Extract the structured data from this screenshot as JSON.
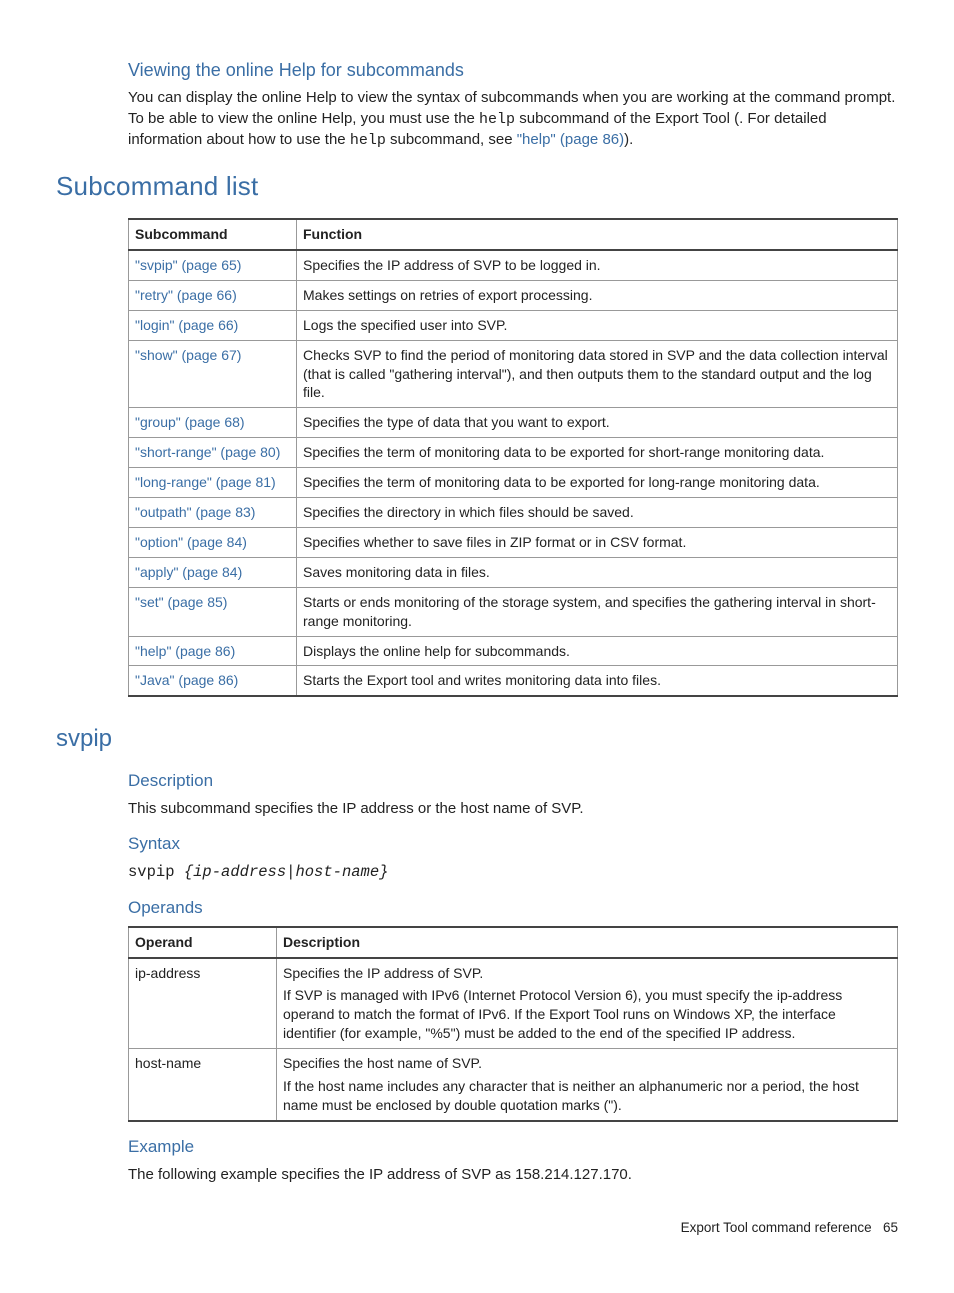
{
  "section1": {
    "heading": "Viewing the online Help for subcommands",
    "para_a": "You can display the online Help to view the syntax of subcommands when you are working at the command prompt. To be able to view the online Help, you must use the ",
    "help1": "help",
    "para_b": " subcommand of the Export Tool (. For detailed information about how to use the ",
    "help2": "help",
    "para_c": " subcommand, see ",
    "link": "\"help\" (page 86)",
    "para_d": ")."
  },
  "subcmd": {
    "heading": "Subcommand list",
    "col1": "Subcommand",
    "col2": "Function",
    "rows": [
      {
        "name": "\"svpip\" (page 65)",
        "func": "Specifies the IP address of SVP to be logged in."
      },
      {
        "name": "\"retry\" (page 66)",
        "func": "Makes settings on retries of export processing."
      },
      {
        "name": "\"login\" (page 66)",
        "func": "Logs the specified user into SVP."
      },
      {
        "name": "\"show\" (page 67)",
        "func": "Checks SVP to find the period of monitoring data stored in SVP and the data collection interval (that is called \"gathering interval\"), and then outputs them to the standard output and the log file."
      },
      {
        "name": "\"group\" (page 68)",
        "func": "Specifies the type of data that you want to export."
      },
      {
        "name": "\"short-range\" (page 80)",
        "func": "Specifies the term of monitoring data to be exported for short-range monitoring data."
      },
      {
        "name": "\"long-range\" (page 81)",
        "func": "Specifies the term of monitoring data to be exported for long-range monitoring data."
      },
      {
        "name": "\"outpath\" (page 83)",
        "func": "Specifies the directory in which files should be saved."
      },
      {
        "name": "\"option\" (page 84)",
        "func": "Specifies whether to save files in ZIP format or in CSV format."
      },
      {
        "name": "\"apply\" (page 84)",
        "func": "Saves monitoring data in files."
      },
      {
        "name": "\"set\" (page 85)",
        "func": "Starts or ends monitoring of the storage system, and specifies the gathering interval in short-range monitoring."
      },
      {
        "name": "\"help\" (page 86)",
        "func": "Displays the online help for subcommands."
      },
      {
        "name": "\"Java\" (page 86)",
        "func": "Starts the Export tool and writes monitoring data into files."
      }
    ]
  },
  "svpip": {
    "heading": "svpip",
    "desc_h": "Description",
    "desc_p": "This subcommand specifies the IP address or the host name of SVP.",
    "syntax_h": "Syntax",
    "syntax_cmd": "svpip",
    "syntax_args": "{ip-address|host-name}",
    "operands_h": "Operands",
    "op_col1": "Operand",
    "op_col2": "Description",
    "ops": [
      {
        "name": "ip-address",
        "line1": "Specifies the IP address of SVP.",
        "line2": "If SVP is managed with IPv6 (Internet Protocol Version 6), you must specify the ip-address operand to match the format of IPv6. If the Export Tool runs on Windows XP, the interface identifier (for example, \"%5\") must be added to the end of the specified IP address."
      },
      {
        "name": "host-name",
        "line1": "Specifies the host name of SVP.",
        "line2": "If the host name includes any character that is neither an alphanumeric nor a period, the host name must be enclosed by double quotation marks (\")."
      }
    ],
    "example_h": "Example",
    "example_p": "The following example specifies the IP address of SVP as 158.214.127.170."
  },
  "footer": {
    "text": "Export Tool command reference",
    "page": "65"
  }
}
